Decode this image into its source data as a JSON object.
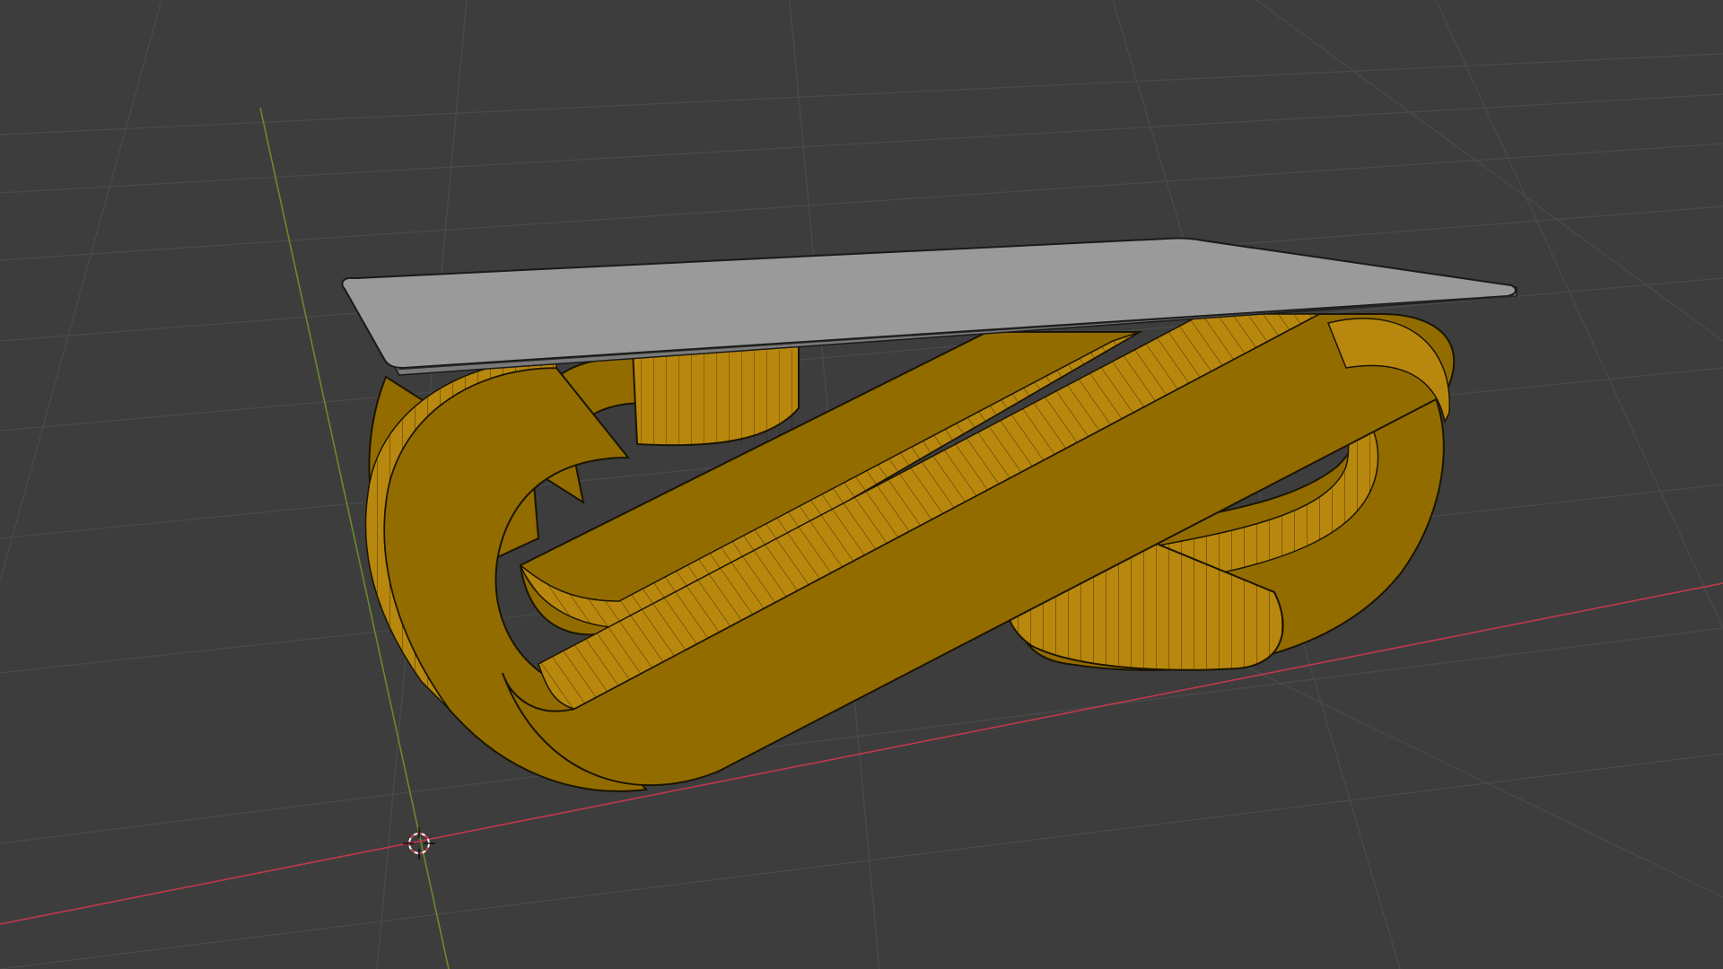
{
  "viewport": {
    "mode": "3D Viewport",
    "background_color": "#3d3d3d",
    "grid_color": "#555555",
    "x_axis_color": "#c2384a",
    "y_axis_color": "#6a8a2a"
  },
  "objects": [
    {
      "name": "tabletop",
      "color": "#9a9a9a",
      "edge_color": "#1a1a1a"
    },
    {
      "name": "table-base",
      "color": "#936c00",
      "shadow_color": "#6b4f00",
      "highlight_color": "#b8870d",
      "wire_color": "#1a1400"
    }
  ],
  "cursor_3d": {
    "icon": "3d-cursor-icon",
    "color": "#d04050"
  }
}
